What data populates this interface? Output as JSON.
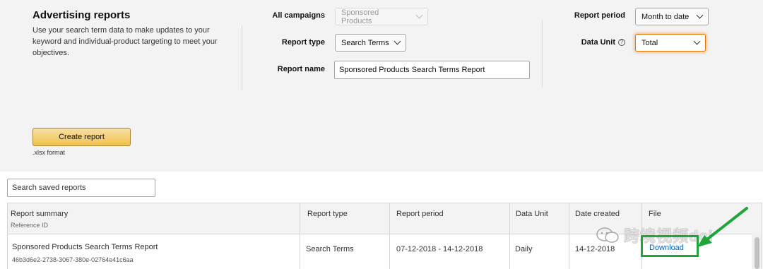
{
  "intro": {
    "title": "Advertising reports",
    "description": "Use your search term data to make updates to your keyword and individual-product targeting to meet your objectives."
  },
  "form": {
    "campaigns_label": "All campaigns",
    "campaigns_value": "Sponsored Products",
    "report_type_label": "Report type",
    "report_type_value": "Search Terms",
    "report_name_label": "Report name",
    "report_name_value": "Sponsored Products Search Terms Report",
    "report_period_label": "Report period",
    "report_period_value": "Month to date",
    "data_unit_label": "Data Unit",
    "data_unit_help_icon": "?",
    "data_unit_value": "Total"
  },
  "actions": {
    "create_label": "Create report",
    "format_note": ".xlsx format"
  },
  "saved_search": {
    "placeholder": "Search saved reports"
  },
  "table": {
    "headers": {
      "summary": "Report summary",
      "reference": "Reference ID",
      "type": "Report type",
      "period": "Report period",
      "unit": "Data Unit",
      "created": "Date created",
      "file": "File"
    },
    "rows": [
      {
        "summary": "Sponsored Products Search Terms Report",
        "reference": "46b3d6e2-2738-3067-380e-02764e41c6aa",
        "type": "Search Terms",
        "period": "07-12-2018 - 14-12-2018",
        "unit": "Daily",
        "created": "14-12-2018",
        "file": "Download"
      }
    ]
  },
  "watermark": {
    "text": "跨境视频dci"
  },
  "colors": {
    "panel_bg": "#f3f3f3",
    "button_yellow": "#f0c14b",
    "focus_orange": "#e77600",
    "link_blue": "#0066c0",
    "annotation_green": "#1fa53a"
  }
}
